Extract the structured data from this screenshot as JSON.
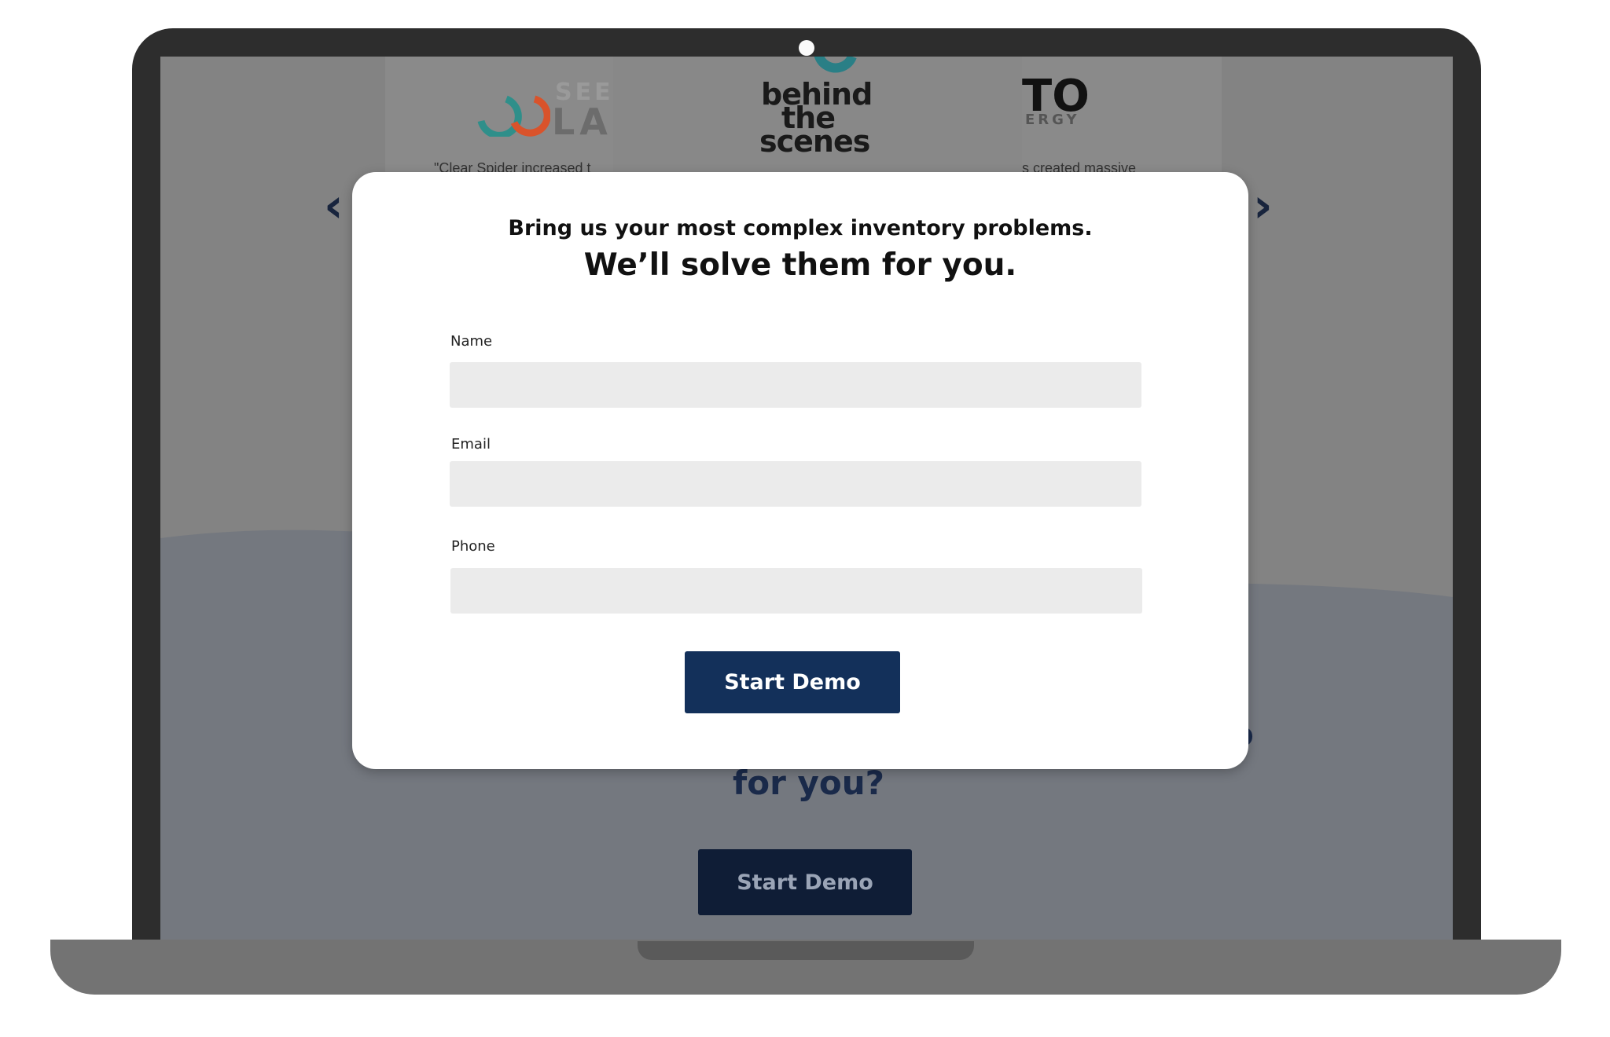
{
  "background_page": {
    "testimonial_cards": [
      {
        "logo_top": "SEED",
        "logo_bottom": "LA",
        "snippet": "\"Clear Spider increased t"
      },
      {
        "logo_line1": "behind",
        "logo_line2": "the",
        "logo_line3": "scenes"
      },
      {
        "logo_top": "TO",
        "logo_bottom": "ERGY",
        "snippet": "s created massive"
      }
    ],
    "prev_arrow": "‹",
    "next_arrow": "›",
    "heading_partial": "for you?",
    "heading_fragment": "o",
    "cta_label": "Start Demo"
  },
  "modal": {
    "subtitle": "Bring us your most complex inventory problems.",
    "title": "We’ll solve them for you.",
    "fields": [
      {
        "label": "Name",
        "value": ""
      },
      {
        "label": "Email",
        "value": ""
      },
      {
        "label": "Phone",
        "value": ""
      }
    ],
    "submit_label": "Start Demo"
  },
  "colors": {
    "overlay_gray": "#838383",
    "lower_section": "#74787f",
    "navy_button": "#13305a",
    "input_fill": "#ebebeb"
  }
}
